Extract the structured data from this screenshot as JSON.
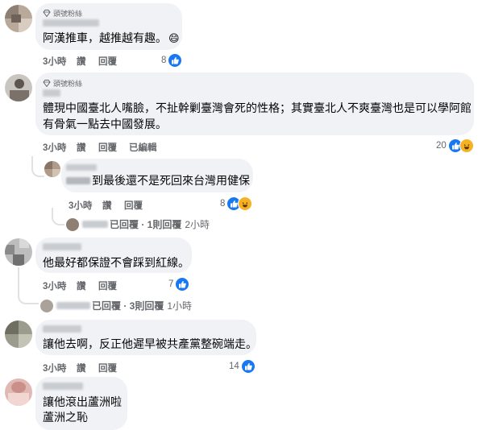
{
  "comments": [
    {
      "badge": "頭號粉絲",
      "text": "阿漢推車，越推越有趣。",
      "emoji": "😄",
      "time": "3小時",
      "like_label": "讚",
      "reply_label": "回覆",
      "reaction_count": "8"
    },
    {
      "badge": "頭號粉絲",
      "text_line1": "體現中國臺北人嘴臉，不扯幹剿臺灣會死的性格；其實臺北人不爽臺灣也是可以學阿館",
      "text_line2": "有骨氣一點去中國發展。",
      "time": "3小時",
      "like_label": "讚",
      "reply_label": "回覆",
      "edited_label": "已編輯",
      "reaction_count": "20"
    },
    {
      "text": "到最後還不是死回來台灣用健保",
      "time": "3小時",
      "like_label": "讚",
      "reply_label": "回覆",
      "reaction_count": "8",
      "replies_summary": "已回覆 · 1則回覆",
      "replies_time": "2小時"
    },
    {
      "text": "他最好都保證不會踩到紅線。",
      "time": "3小時",
      "like_label": "讚",
      "reply_label": "回覆",
      "reaction_count": "7",
      "replies_summary": "已回覆 · 3則回覆",
      "replies_time": "1小時"
    },
    {
      "text": "讓他去啊，反正他遲早被共產黨整碗端走。",
      "time": "3小時",
      "like_label": "讚",
      "reply_label": "回覆",
      "reaction_count": "14"
    },
    {
      "text_line1": "讓他滾出蘆洲啦",
      "text_line2": "蘆洲之恥"
    }
  ],
  "colors": {
    "bubble": "#f0f2f5",
    "like_blue": "#1877f2",
    "haha_yellow": "#f7b125",
    "meta_gray": "#65676b"
  }
}
